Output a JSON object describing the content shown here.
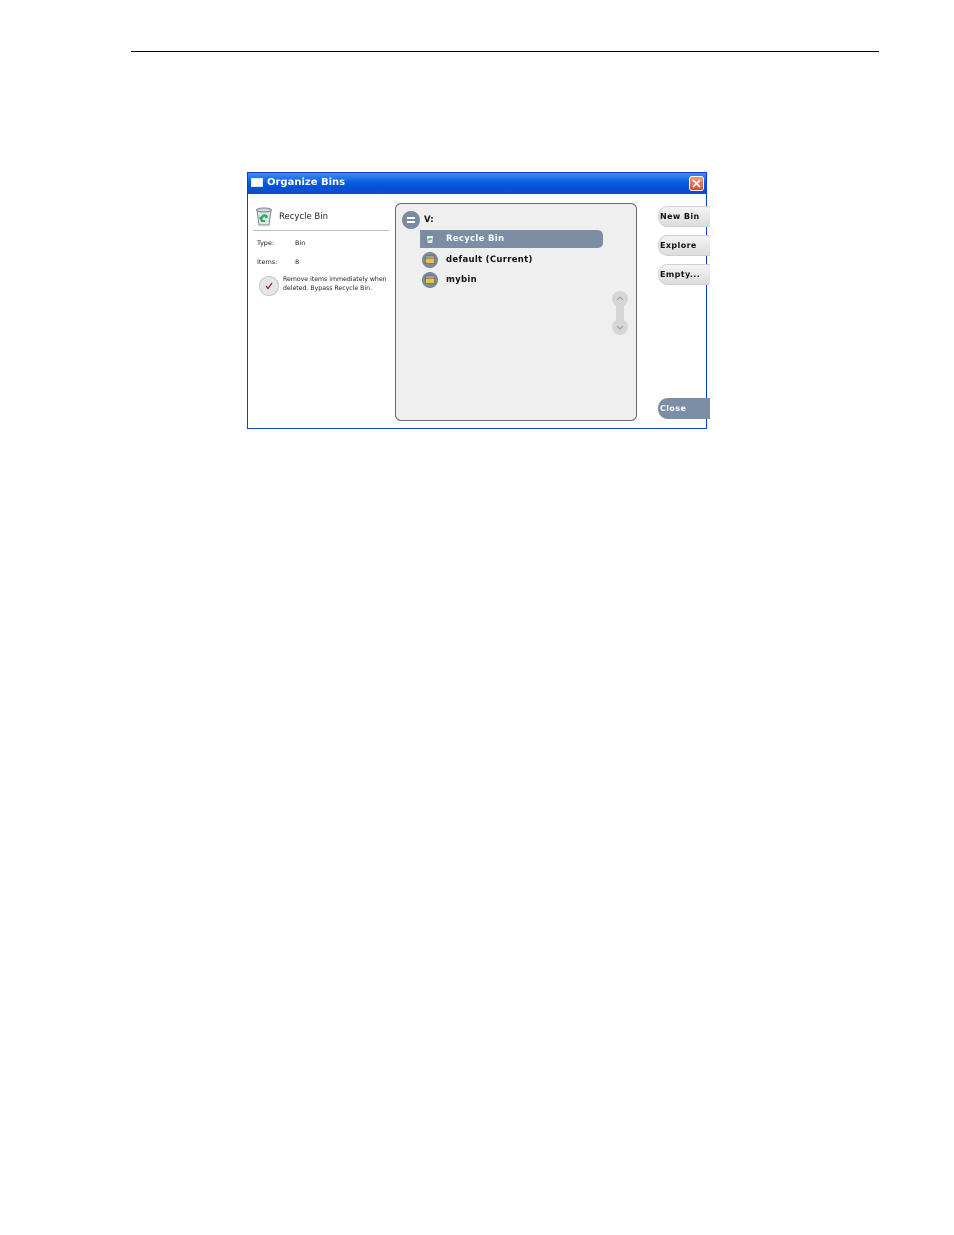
{
  "dialog": {
    "title": "Organize Bins",
    "properties": {
      "name": "Recycle Bin",
      "type_label": "Type:",
      "type_value": "Bin",
      "items_label": "Items:",
      "items_value": "8",
      "bypass_text": "Remove items immediately when deleted. Bypass Recycle Bin.",
      "bypass_checked": true
    },
    "tree": {
      "drive": "V:",
      "bins": [
        {
          "label": "Recycle Bin",
          "selected": true,
          "icon": "recycle-bin-icon"
        },
        {
          "label": "default (Current)",
          "selected": false,
          "icon": "bin-icon"
        },
        {
          "label": "mybin",
          "selected": false,
          "icon": "bin-icon"
        }
      ]
    },
    "buttons": {
      "new_bin": "New Bin",
      "explore": "Explore",
      "empty": "Empty...",
      "close": "Close"
    }
  },
  "colors": {
    "titlebar": "#0a5ce0",
    "selection": "#7b8ea6",
    "panel": "#efefef"
  }
}
